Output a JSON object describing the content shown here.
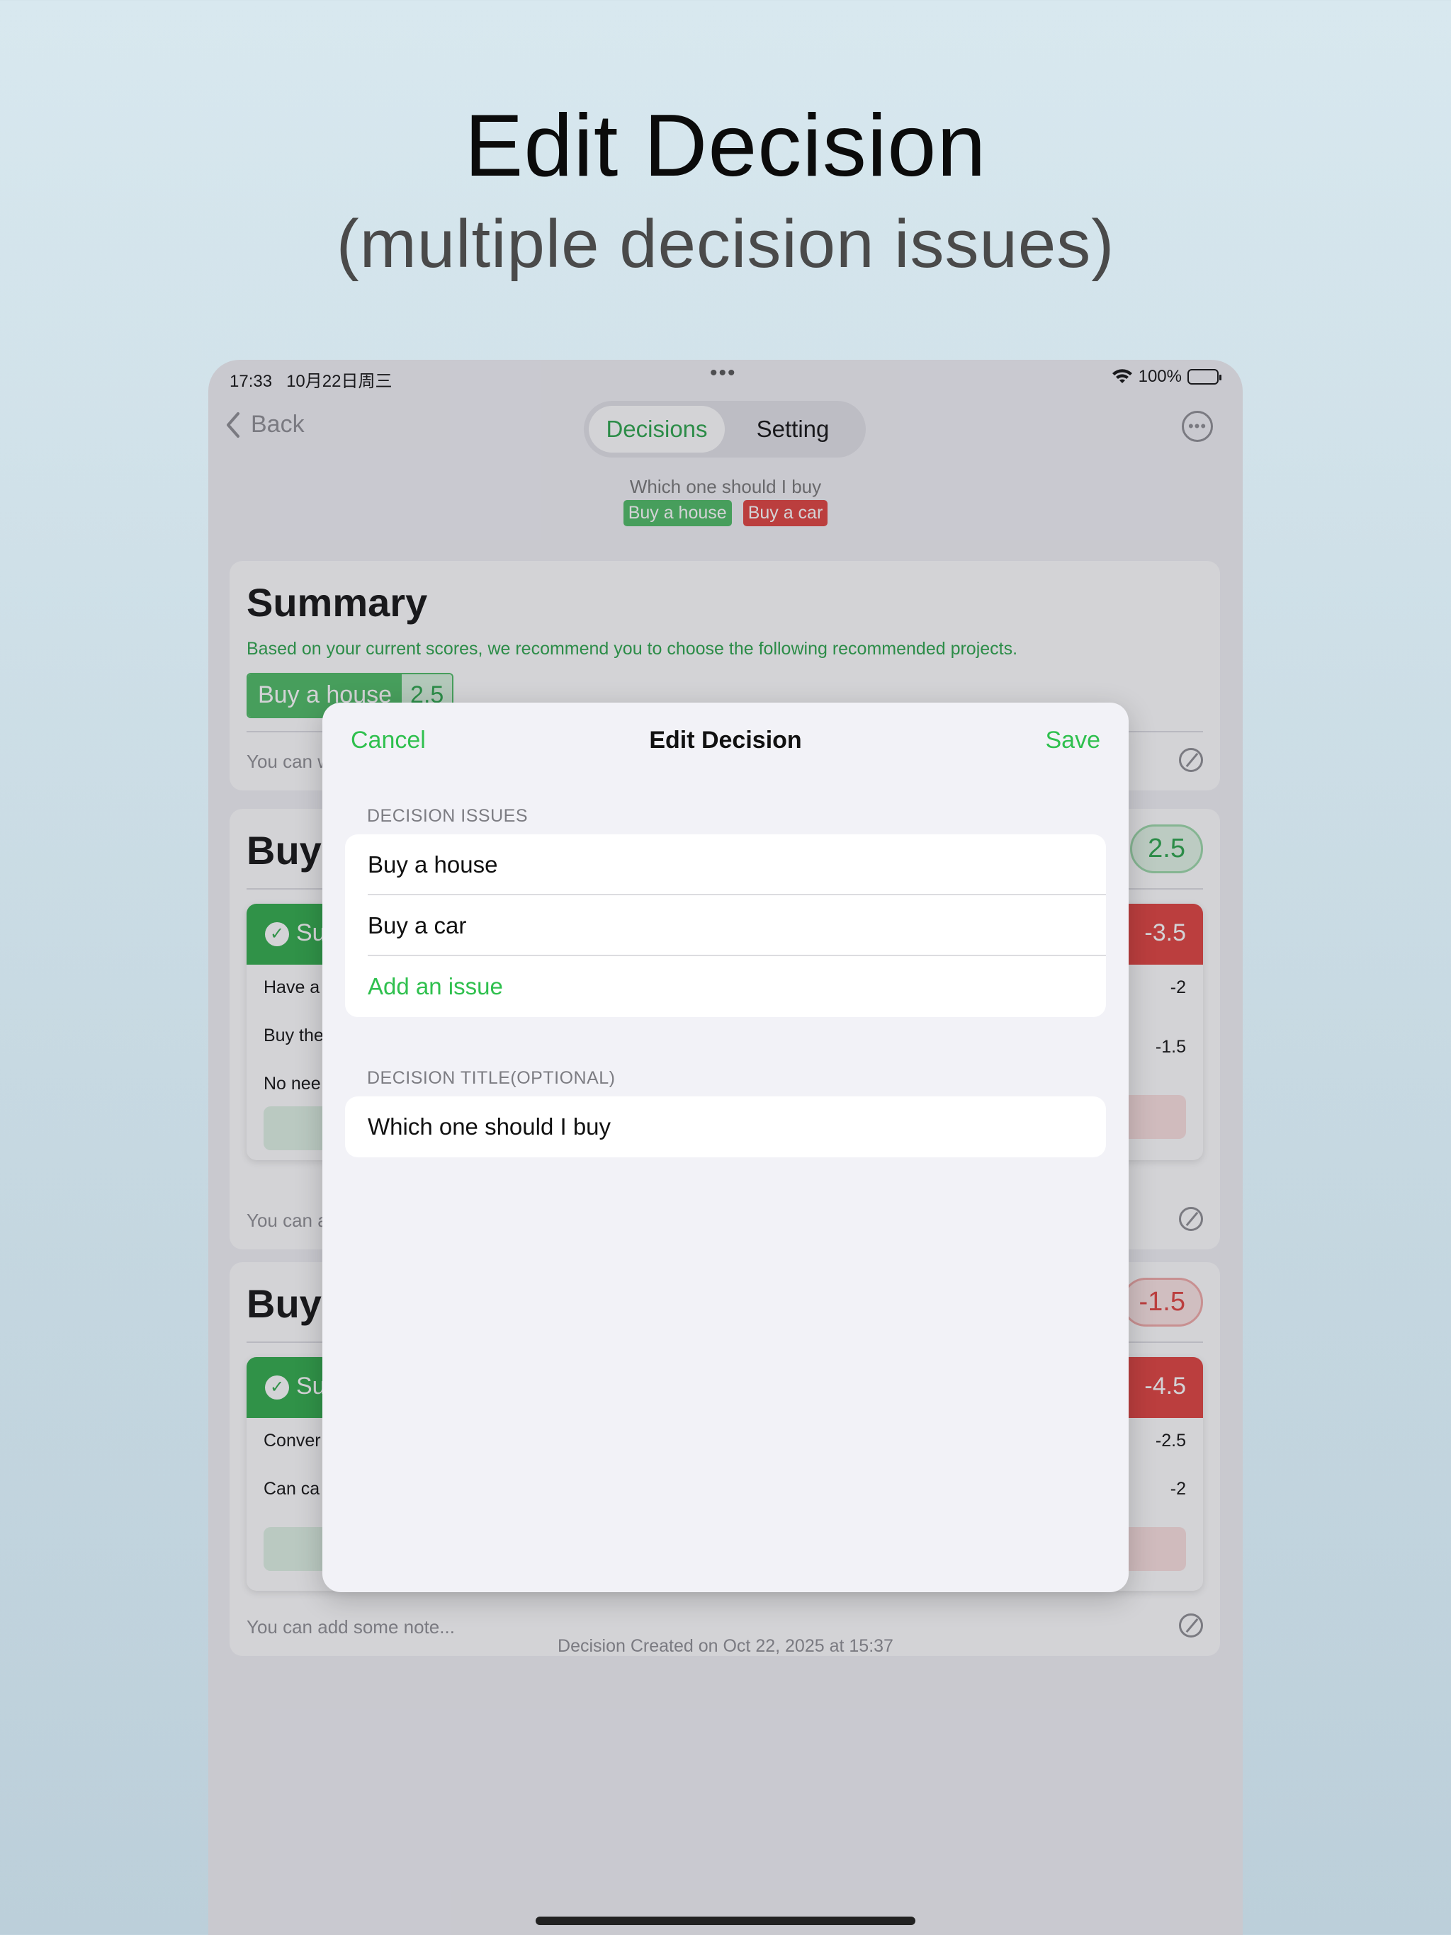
{
  "headline": {
    "title": "Edit Decision",
    "subtitle": "(multiple decision issues)"
  },
  "status_bar": {
    "time": "17:33",
    "date": "10月22日周三",
    "center_dots": "•••",
    "battery_percent": "100%"
  },
  "nav": {
    "back_label": "Back",
    "tabs": [
      {
        "label": "Decisions",
        "active": true
      },
      {
        "label": "Setting",
        "active": false
      }
    ]
  },
  "decision": {
    "title": "Which one should I buy",
    "issue_chips": [
      {
        "label": "Buy a house",
        "color": "#4cbb63"
      },
      {
        "label": "Buy a car",
        "color": "#e0413d"
      }
    ]
  },
  "summary": {
    "heading": "Summary",
    "recommendation": "Based on your current scores, we recommend you to choose the following recommended projects.",
    "recommended_issue": "Buy a house",
    "recommended_score": "2.5",
    "note_placeholder": "You can w"
  },
  "issue_cards": [
    {
      "heading": "Buy",
      "score": "2.5",
      "pros_label": "Su",
      "cons_total": "-3.5",
      "pros_rows": [
        "Have a",
        "Buy the",
        "No nee"
      ],
      "cons_rows": [
        "-2",
        "-1.5"
      ],
      "note_placeholder": "You can a"
    },
    {
      "heading": "Buy",
      "score": "-1.5",
      "pros_label": "Su",
      "cons_total": "-4.5",
      "pros_rows": [
        "Conver",
        "Can ca"
      ],
      "cons_rows": [
        "-2.5",
        "-2"
      ],
      "note_placeholder": "You can add some note..."
    }
  ],
  "footer": {
    "created": "Decision Created on Oct 22, 2025 at 15:37"
  },
  "modal": {
    "cancel_label": "Cancel",
    "title": "Edit Decision",
    "save_label": "Save",
    "issues_section_label": "DECISION ISSUES",
    "issues": [
      "Buy a house",
      "Buy a car"
    ],
    "add_issue_label": "Add an issue",
    "title_section_label": "DECISION TITLE(OPTIONAL)",
    "title_value": "Which one should I buy"
  },
  "colors": {
    "accent_green": "#2fc04e",
    "negative_red": "#e0413d"
  }
}
